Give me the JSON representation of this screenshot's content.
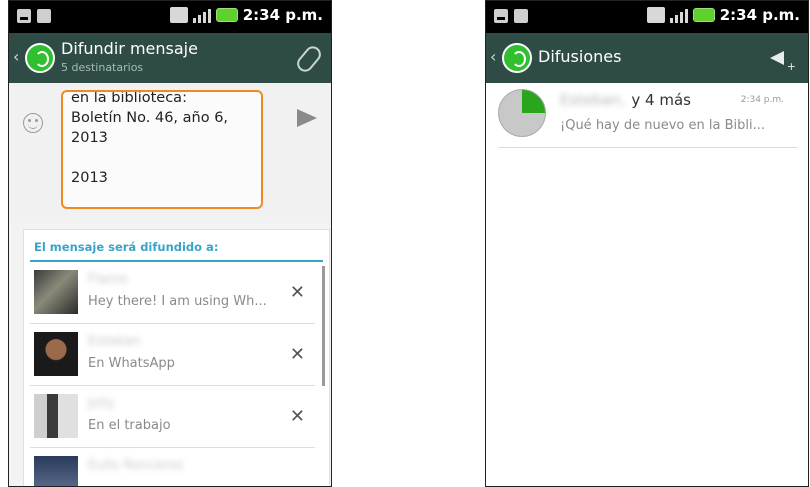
{
  "left_screen": {
    "status_time": "2:34 p.m.",
    "title": "Difundir mensaje",
    "subtitle": "5 destinatarios",
    "message_text": "en la biblioteca:\nBoletín No. 46, año 6,\n2013\n\n2013",
    "list_header": "El mensaje será difundido a:",
    "recipients": [
      {
        "name": "Flame",
        "status": "Hey there! I am using Wh..."
      },
      {
        "name": "Esteban",
        "status": "En WhatsApp"
      },
      {
        "name": "Jolly",
        "status": "En el trabajo"
      },
      {
        "name": "Eulio Ronceros",
        "status": ""
      }
    ],
    "remove_glyph": "✕"
  },
  "right_screen": {
    "status_time": "2:34 p.m.",
    "title": "Difusiones",
    "conversation": {
      "first_name": "Esteban,",
      "others": "y 4 más",
      "time": "2:34 p.m.",
      "preview": "¡Qué hay de nuevo en la Bibli..."
    }
  }
}
